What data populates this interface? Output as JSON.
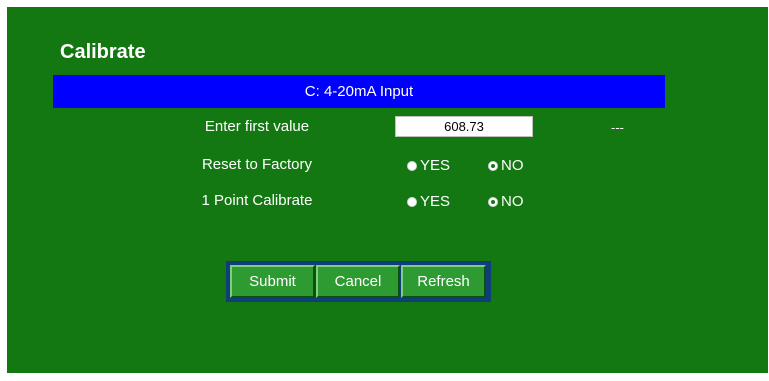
{
  "page": {
    "title": "Calibrate",
    "section_header": "C: 4-20mA Input"
  },
  "rows": {
    "first_value": {
      "label": "Enter first value",
      "value": "608.73",
      "note": "---"
    },
    "reset_factory": {
      "label": "Reset to Factory",
      "options": [
        "YES",
        "NO"
      ],
      "selected": "NO"
    },
    "one_point": {
      "label": "1 Point Calibrate",
      "options": [
        "YES",
        "NO"
      ],
      "selected": "NO"
    }
  },
  "buttons": {
    "submit": "Submit",
    "cancel": "Cancel",
    "refresh": "Refresh"
  },
  "colors": {
    "panel_bg": "#137812",
    "header_bar": "#0000ff",
    "button_bg": "#2e9a32",
    "button_group_bg": "#0f3f7a"
  }
}
